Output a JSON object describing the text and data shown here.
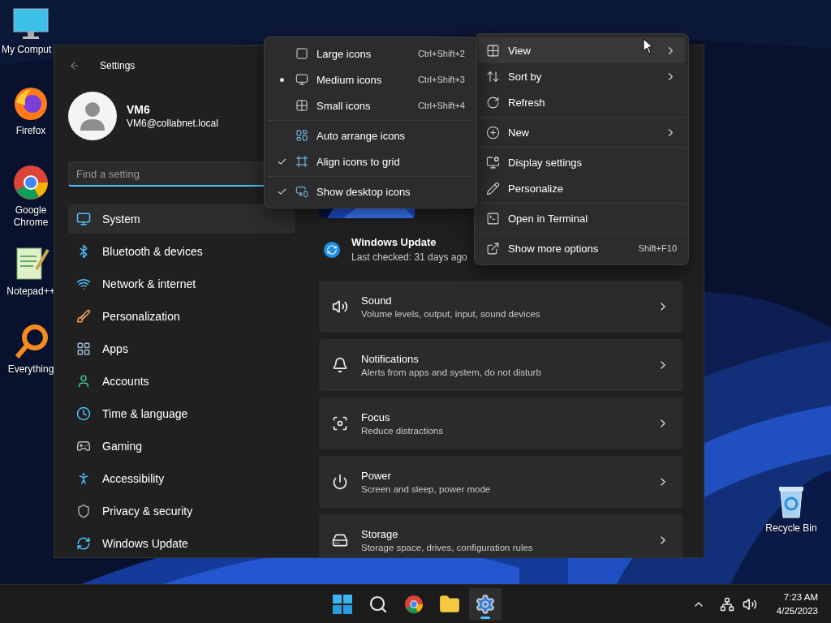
{
  "desktop_icons": [
    {
      "kind": "computer",
      "label": "My Comput"
    },
    {
      "kind": "fox",
      "label": "Firefox"
    },
    {
      "kind": "chrome",
      "label": "Google Chrome"
    },
    {
      "kind": "notepad",
      "label": "Notepad++"
    },
    {
      "kind": "magnifier",
      "label": "Everything"
    },
    {
      "kind": "recycle",
      "label": "Recycle Bin"
    }
  ],
  "settings": {
    "title": "Settings",
    "user": {
      "name": "VM6",
      "email": "VM6@collabnet.local"
    },
    "search": {
      "placeholder": "Find a setting"
    },
    "nav": [
      {
        "kind": "system",
        "label": "System",
        "selected": true
      },
      {
        "kind": "bluetooth",
        "label": "Bluetooth & devices",
        "selected": false
      },
      {
        "kind": "network",
        "label": "Network & internet",
        "selected": false
      },
      {
        "kind": "brush",
        "label": "Personalization",
        "selected": false
      },
      {
        "kind": "apps",
        "label": "Apps",
        "selected": false
      },
      {
        "kind": "accounts",
        "label": "Accounts",
        "selected": false
      },
      {
        "kind": "time",
        "label": "Time & language",
        "selected": false
      },
      {
        "kind": "gaming",
        "label": "Gaming",
        "selected": false
      },
      {
        "kind": "accessibility",
        "label": "Accessibility",
        "selected": false
      },
      {
        "kind": "privacy",
        "label": "Privacy & security",
        "selected": false
      },
      {
        "kind": "update",
        "label": "Windows Update",
        "selected": false
      }
    ],
    "update": {
      "title": "Windows Update",
      "subtitle": "Last checked: 31 days ago"
    },
    "cards": [
      {
        "kind": "sound",
        "title": "Sound",
        "subtitle": "Volume levels, output, input, sound devices"
      },
      {
        "kind": "bell",
        "title": "Notifications",
        "subtitle": "Alerts from apps and system, do not disturb"
      },
      {
        "kind": "focus",
        "title": "Focus",
        "subtitle": "Reduce distractions"
      },
      {
        "kind": "power",
        "title": "Power",
        "subtitle": "Screen and sleep, power mode"
      },
      {
        "kind": "storage",
        "title": "Storage",
        "subtitle": "Storage space, drives, configuration rules"
      }
    ]
  },
  "context_menu": {
    "sections": [
      {
        "items": [
          {
            "kind": "view",
            "label": "View",
            "submenu": true,
            "hovered": true
          },
          {
            "kind": "sort",
            "label": "Sort by",
            "submenu": true,
            "hovered": false
          },
          {
            "kind": "refresh",
            "label": "Refresh",
            "submenu": false,
            "hovered": false
          }
        ]
      },
      {
        "items": [
          {
            "kind": "new",
            "label": "New",
            "submenu": true,
            "hovered": false
          }
        ]
      },
      {
        "items": [
          {
            "kind": "display",
            "label": "Display settings",
            "submenu": false,
            "hovered": false
          },
          {
            "kind": "personalize",
            "label": "Personalize",
            "submenu": false,
            "hovered": false
          }
        ]
      },
      {
        "items": [
          {
            "kind": "terminal",
            "label": "Open in Terminal",
            "submenu": false,
            "hovered": false
          }
        ]
      },
      {
        "items": [
          {
            "kind": "more",
            "label": "Show more options",
            "shortcut": "Shift+F10",
            "submenu": false,
            "hovered": false
          }
        ]
      }
    ]
  },
  "view_submenu": {
    "sections": [
      {
        "items": [
          {
            "kind": "large",
            "label": "Large icons",
            "shortcut": "Ctrl+Shift+2",
            "selected": false
          },
          {
            "kind": "medium",
            "label": "Medium icons",
            "shortcut": "Ctrl+Shift+3",
            "selected": true
          },
          {
            "kind": "small",
            "label": "Small icons",
            "shortcut": "Ctrl+Shift+4",
            "selected": false
          }
        ]
      },
      {
        "items": [
          {
            "kind": "auto",
            "label": "Auto arrange icons",
            "checked": false
          },
          {
            "kind": "grid",
            "label": "Align icons to grid",
            "checked": true
          }
        ]
      },
      {
        "items": [
          {
            "kind": "showdesk",
            "label": "Show desktop icons",
            "checked": true
          }
        ]
      }
    ]
  },
  "taskbar": {
    "apps": [
      {
        "kind": "start",
        "active": false
      },
      {
        "kind": "search",
        "active": false
      },
      {
        "kind": "chrome",
        "active": false
      },
      {
        "kind": "folder",
        "active": false
      },
      {
        "kind": "settings",
        "active": true
      }
    ],
    "time": "7:23 AM",
    "date": "4/25/2023"
  }
}
